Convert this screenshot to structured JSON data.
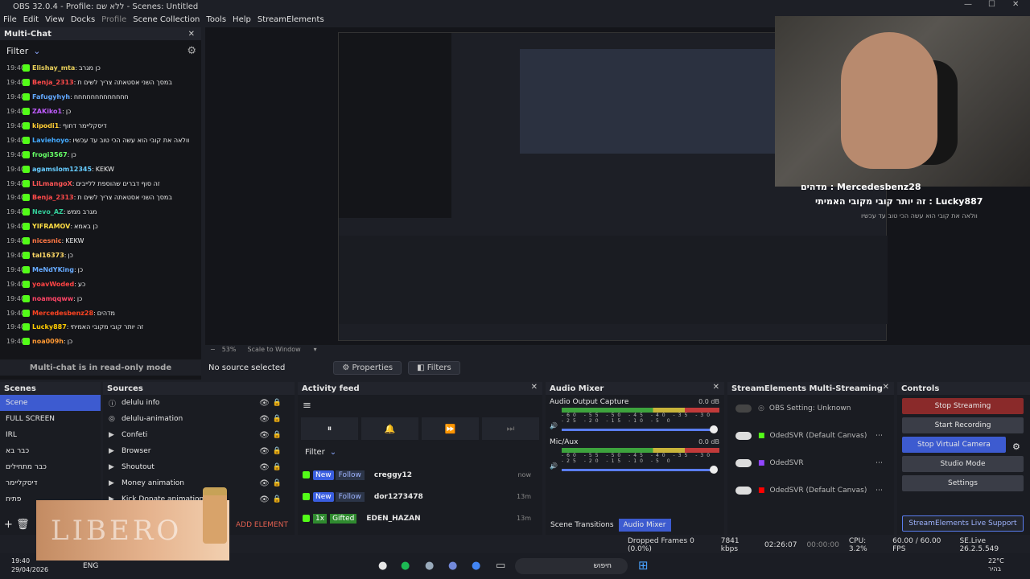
{
  "window": {
    "title": "OBS 32.0.4 - Profile: ללא שם - Scenes: Untitled",
    "min": "—",
    "max": "☐",
    "close": "✕"
  },
  "menu": [
    "File",
    "Edit",
    "View",
    "Docks",
    "Profile",
    "Scene Collection",
    "Tools",
    "Help",
    "StreamElements"
  ],
  "multichat": {
    "title": "Multi-Chat",
    "filter": "Filter",
    "footer": "Multi-chat is in read-only mode",
    "messages": [
      {
        "time": "19:40",
        "user": "Elishay_mta",
        "ucolor": "#e8cf5a",
        "msg": "כן מגרב"
      },
      {
        "time": "19:40",
        "user": "Benja_2313",
        "ucolor": "#ff4a4a",
        "msg": "במסך השני אסטאתה צריך לשים ת"
      },
      {
        "time": "19:40",
        "user": "Fafugyhyh",
        "ucolor": "#62a8ff",
        "msg": "חחחחחחחחחחחחח"
      },
      {
        "time": "19:40",
        "user": "ZAKiko1",
        "ucolor": "#c05cff",
        "msg": "כן"
      },
      {
        "time": "19:40",
        "user": "kipodi1",
        "ucolor": "#ffcc33",
        "msg": "דיסקליימר דחוף"
      },
      {
        "time": "19:40",
        "user": "Laviehoyo",
        "ucolor": "#44aaff",
        "msg": "וולאה את קובי הוא עשה הכי טוב עד עכשיו"
      },
      {
        "time": "19:40",
        "user": "frogi3567",
        "ucolor": "#66ff66",
        "msg": "כן"
      },
      {
        "time": "19:40",
        "user": "agamslom12345",
        "ucolor": "#66ccff",
        "msg": "KEKW"
      },
      {
        "time": "19:40",
        "user": "LiLmangoX",
        "ucolor": "#ff5555",
        "msg": "זה סוף דברים שהוספת ללייבים"
      },
      {
        "time": "19:40",
        "user": "Benja_2313",
        "ucolor": "#ff4a4a",
        "msg": "במסך השני אסטאתה צריך לשים ת"
      },
      {
        "time": "19:40",
        "user": "Nevo_AZ",
        "ucolor": "#33cc99",
        "msg": "מגרב ממש"
      },
      {
        "time": "19:40",
        "user": "YIFRAMOV",
        "ucolor": "#ffdd44",
        "msg": "כן באמא"
      },
      {
        "time": "19:40",
        "user": "nicesnic",
        "ucolor": "#ff7744",
        "msg": "KEKW"
      },
      {
        "time": "19:40",
        "user": "tal16373",
        "ucolor": "#ffd966",
        "msg": "כן"
      },
      {
        "time": "19:40",
        "user": "MeNdYKing",
        "ucolor": "#66aaff",
        "msg": "כן"
      },
      {
        "time": "19:40",
        "user": "yoavWoded",
        "ucolor": "#ff4444",
        "msg": "כע"
      },
      {
        "time": "19:40",
        "user": "noamqqww",
        "ucolor": "#ff4466",
        "msg": "כן"
      },
      {
        "time": "19:40",
        "user": "Mercedesbenz28",
        "ucolor": "#ff4422",
        "msg": "מדהים"
      },
      {
        "time": "19:40",
        "user": "Lucky887",
        "ucolor": "#ffcc00",
        "msg": "זה יותר קובי מקובי האמיתי"
      },
      {
        "time": "19:40",
        "user": "noa009h",
        "ucolor": "#ff9933",
        "msg": "כן"
      }
    ]
  },
  "overlay": {
    "line1": "מדהים : Mercedesbenz28",
    "line2": "זה יותר קובי מקובי האמיתי : Lucky887",
    "line3": "וולאה את קובי הוא עשה הכי טוב עד עכשיו"
  },
  "preview": {
    "zoom": "53%",
    "scale_mode": "Scale to Window",
    "no_source": "No source selected",
    "properties": "Properties",
    "filters": "Filters"
  },
  "scenes": {
    "title": "Scenes",
    "items": [
      "Scene",
      "FULL SCREEN",
      "IRL",
      "כבר בא",
      "כבר מתחילים",
      "דיסקליימר",
      "פתיח"
    ]
  },
  "sources": {
    "title": "Sources",
    "items": [
      {
        "name": "delulu info",
        "icon": "ⓘ"
      },
      {
        "name": "delulu-animation",
        "icon": "◎"
      },
      {
        "name": "Confeti",
        "icon": "▶"
      },
      {
        "name": "Browser",
        "icon": "▶"
      },
      {
        "name": "Shoutout",
        "icon": "▶"
      },
      {
        "name": "Money animation",
        "icon": "▶"
      },
      {
        "name": "Kick Donate animation",
        "icon": "▶"
      }
    ],
    "add_element": "ADD ELEMENT"
  },
  "activity": {
    "title": "Activity feed",
    "filter": "Filter",
    "events": [
      {
        "type": "New",
        "action": "Follow",
        "user": "creggy12",
        "when": "now"
      },
      {
        "type": "New",
        "action": "Follow",
        "user": "dor1273478",
        "when": "13m"
      },
      {
        "type": "1x",
        "action": "Gifted",
        "user": "EDEN_HAZAN",
        "when": "13m"
      }
    ]
  },
  "audio": {
    "title": "Audio Mixer",
    "channels": [
      {
        "name": "Audio Output Capture",
        "db": "0.0 dB"
      },
      {
        "name": "Mic/Aux",
        "db": "0.0 dB"
      }
    ],
    "ticks": "-60 -55 -50 -45 -40 -35 -30 -25 -20 -15 -10 -5 0",
    "tab1": "Scene Transitions",
    "tab2": "Audio Mixer"
  },
  "multistream": {
    "title": "StreamElements Multi-Streaming",
    "rows": [
      {
        "label": "OBS Setting: Unknown"
      },
      {
        "label": "OdedSVR (Default Canvas)"
      },
      {
        "label": "OdedSVR"
      },
      {
        "label": "OdedSVR (Default Canvas)"
      }
    ]
  },
  "controls": {
    "title": "Controls",
    "buttons": [
      "Stop Streaming",
      "Start Recording",
      "Stop Virtual Camera",
      "Studio Mode",
      "Settings"
    ],
    "support": "StreamElements Live Support"
  },
  "status": {
    "dropped": "Dropped Frames 0 (0.0%)",
    "kbps": "7841 kbps",
    "stream_time": "02:26:07",
    "rec_time": "00:00:00",
    "cpu": "CPU: 3.2%",
    "fps": "60.00 / 60.00 FPS",
    "version": "SE.Live 26.2.5.549"
  },
  "taskbar": {
    "time": "19:40",
    "date": "29/04/2026",
    "lang": "ENG",
    "search": "חיפוש",
    "temp": "22°C",
    "weather": "בהיר"
  },
  "libero": "LIBERO"
}
